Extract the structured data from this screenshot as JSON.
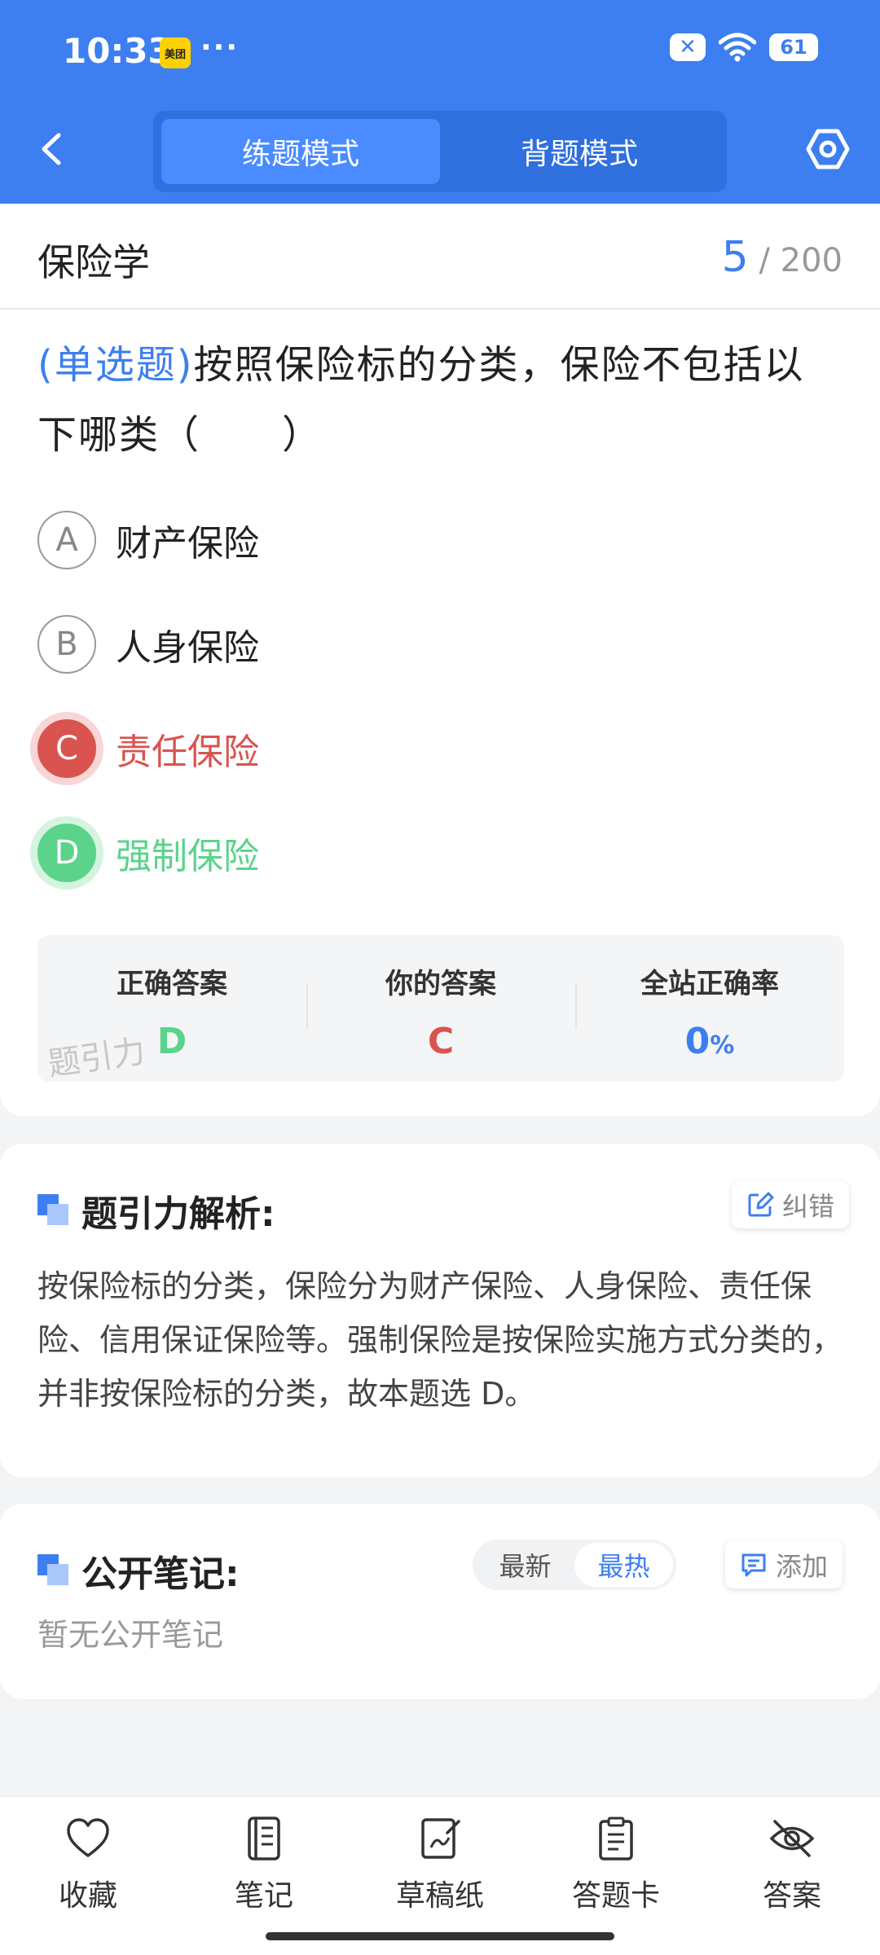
{
  "status_bar": {
    "time": "10:33",
    "app_badge": "美团",
    "more": "···",
    "x_icon_label": "✕",
    "battery": "61"
  },
  "nav": {
    "tabs": [
      "练题模式",
      "背题模式"
    ],
    "active_tab": 0
  },
  "question": {
    "subject": "保险学",
    "current": "5",
    "total": "/ 200",
    "type": "(单选题)",
    "text": "按照保险标的分类，保险不包括以下哪类（　　）",
    "options": [
      {
        "letter": "A",
        "text": "财产保险",
        "state": "normal"
      },
      {
        "letter": "B",
        "text": "人身保险",
        "state": "normal"
      },
      {
        "letter": "C",
        "text": "责任保险",
        "state": "wrong"
      },
      {
        "letter": "D",
        "text": "强制保险",
        "state": "correct"
      }
    ]
  },
  "stats": {
    "correct_label": "正确答案",
    "correct_value": "D",
    "yours_label": "你的答案",
    "yours_value": "C",
    "rate_label": "全站正确率",
    "rate_value": "0",
    "rate_unit": "%",
    "watermark": "题引力"
  },
  "analysis": {
    "title": "题引力解析:",
    "report_label": "纠错",
    "text": "按保险标的分类，保险分为财产保险、人身保险、责任保险、信用保证保险等。强制保险是按保险实施方式分类的，并非按保险标的分类，故本题选 D。"
  },
  "notes": {
    "title": "公开笔记:",
    "sort_options": [
      "最新",
      "最热"
    ],
    "active_sort": 1,
    "add_label": "添加",
    "empty_text": "暂无公开笔记"
  },
  "bottom_bar": {
    "items": [
      {
        "label": "收藏",
        "icon": "heart-icon"
      },
      {
        "label": "笔记",
        "icon": "notebook-icon"
      },
      {
        "label": "草稿纸",
        "icon": "draft-icon"
      },
      {
        "label": "答题卡",
        "icon": "answer-card-icon"
      },
      {
        "label": "答案",
        "icon": "eye-off-icon"
      }
    ]
  },
  "colors": {
    "primary": "#3d7ff0",
    "wrong": "#d9534f",
    "correct": "#5bd38a"
  }
}
